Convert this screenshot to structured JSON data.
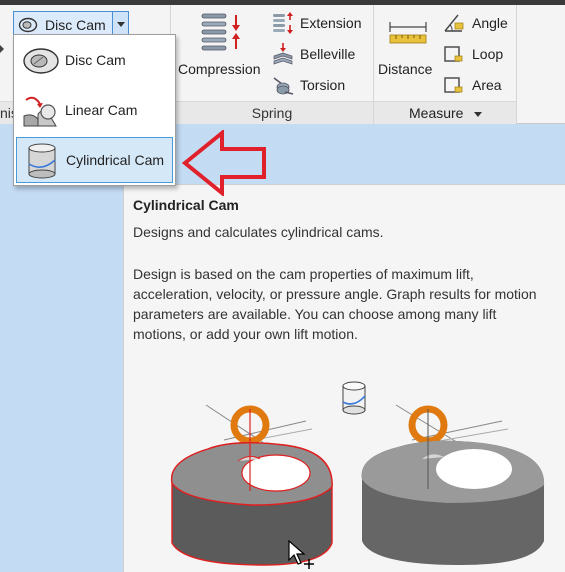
{
  "ribbon": {
    "cam_group": {
      "disc_cam_label": "Disc Cam",
      "panel_label_fragment": "nis"
    },
    "spring_group": {
      "compression_label": "Compression",
      "extension_label": "Extension",
      "belleville_label": "Belleville",
      "torsion_label": "Torsion",
      "panel_label": "Spring"
    },
    "measure_group": {
      "distance_label": "Distance",
      "angle_label": "Angle",
      "loop_label": "Loop",
      "area_label": "Area",
      "panel_label": "Measure"
    }
  },
  "dropdown": {
    "items": [
      {
        "label": "Disc Cam",
        "icon": "disc-cam-icon",
        "selected": false
      },
      {
        "label": "Linear Cam",
        "icon": "linear-cam-icon",
        "selected": false
      },
      {
        "label": "Cylindrical Cam",
        "icon": "cylindrical-cam-icon",
        "selected": true
      }
    ]
  },
  "tooltip": {
    "title": "Cylindrical Cam",
    "summary": "Designs and calculates cylindrical cams.",
    "description_lines": [
      "Design is based on the cam properties of maximum lift,",
      "acceleration, velocity, or pressure angle. Graph results for motion",
      "parameters are available. You can choose among many lift",
      "motions, or add your own lift motion."
    ]
  },
  "colors": {
    "selection_border": "#4a9ad8",
    "selection_fill": "#d5e8f8",
    "canvas_blue": "#c3dbf3",
    "annotation_arrow": "#e0202a",
    "cam_highlight": "#e02020"
  }
}
